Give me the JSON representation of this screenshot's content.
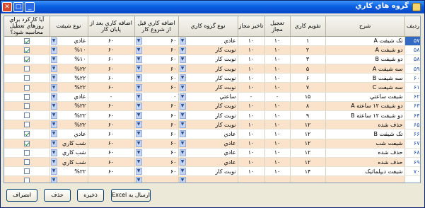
{
  "window": {
    "title": "گروه هاي كاري"
  },
  "titlebar": {
    "minimize": "_",
    "maximize": "□",
    "close": "✕"
  },
  "grid": {
    "headers": {
      "cb": "آيا كاركرد براي روزهاي تعطيل محاسبه شود؟",
      "shift_type": "نوع شيفت",
      "extra_after": "اضافه كاري بعد از پايان كار",
      "extra_before": "اضافه كاري قبل از شروع كار",
      "group_type": "نوع گروه كاري",
      "delay": "تاخير مجاز",
      "early": "تعجيل مجاز",
      "calendar": "تقويم كاري",
      "desc": "شرح",
      "id": "رديف"
    },
    "rows": [
      {
        "id": "۵۷",
        "desc": "تک شيفت A",
        "calendar": "۱",
        "early": "۱۰",
        "delay": "۱۰",
        "group_type": "عادي",
        "extra_before": "۶۰",
        "extra_after": "۶۰",
        "shift_type": "عادي",
        "checked": true
      },
      {
        "id": "۵۸",
        "desc": "دو شيفت A",
        "calendar": "۲",
        "early": "۱۰",
        "delay": "۱۰",
        "group_type": "نوبت كار",
        "extra_before": "۶۰",
        "extra_after": "۶۰",
        "shift_type": "%۱۰",
        "checked": true
      },
      {
        "id": "۵۸",
        "desc": "دو شيفت B",
        "calendar": "۳",
        "early": "۱۰",
        "delay": "۱۰",
        "group_type": "نوبت كار",
        "extra_before": "۶۰",
        "extra_after": "۶۰",
        "shift_type": "%۱۰",
        "checked": true
      },
      {
        "id": "۵۹",
        "desc": "سه شيفت A",
        "calendar": "۵",
        "early": "۱۰",
        "delay": "۱۰",
        "group_type": "نوبت كار",
        "extra_before": "۶۰",
        "extra_after": "۶۰",
        "shift_type": "%۲۲",
        "checked": false
      },
      {
        "id": "۶۰",
        "desc": "سه شيفت B",
        "calendar": "۶",
        "early": "۱۰",
        "delay": "۱۰",
        "group_type": "نوبت كار",
        "extra_before": "۶۰",
        "extra_after": "۶۰",
        "shift_type": "%۲۲",
        "checked": false
      },
      {
        "id": "۶۱",
        "desc": "سه شيفت C",
        "calendar": "۷",
        "early": "۱۰",
        "delay": "۱۰",
        "group_type": "نوبت كار",
        "extra_before": "۶۰",
        "extra_after": "۶۰",
        "shift_type": "%۲۲",
        "checked": false
      },
      {
        "id": "۶۲",
        "desc": "شيفت ساعتي",
        "calendar": "۱۵",
        "early": "۰",
        "delay": "۰",
        "group_type": "ساعتي",
        "extra_before": "۰",
        "extra_after": "۰",
        "shift_type": "عادي",
        "checked": false
      },
      {
        "id": "۶۳",
        "desc": "دو شيفت ۱۲ ساعته A",
        "calendar": "۸",
        "early": "۱۰",
        "delay": "۱۰",
        "group_type": "نوبت كار",
        "extra_before": "۶۰",
        "extra_after": "۶۰",
        "shift_type": "%۲۲",
        "checked": false
      },
      {
        "id": "۶۴",
        "desc": "دو شيفت ۱۲ ساعته B",
        "calendar": "۹",
        "early": "۱۰",
        "delay": "۱۰",
        "group_type": "نوبت كار",
        "extra_before": "۶۰",
        "extra_after": "۶۰",
        "shift_type": "%۲۲",
        "checked": false
      },
      {
        "id": "۶۵",
        "desc": "حذف شده",
        "calendar": "۱۲",
        "early": "۱۰",
        "delay": "۱۰",
        "group_type": "نوبت كار",
        "extra_before": "۶۰",
        "extra_after": "۶۰",
        "shift_type": "%۲۲",
        "checked": false
      },
      {
        "id": "۶۶",
        "desc": "تک شيفت B",
        "calendar": "۱۲",
        "early": "۱۰",
        "delay": "۱۰",
        "group_type": "عادي",
        "extra_before": "۶۰",
        "extra_after": "۶۰",
        "shift_type": "عادي",
        "checked": true
      },
      {
        "id": "۶۷",
        "desc": "شيفت شب",
        "calendar": "۱۲",
        "early": "۱۰",
        "delay": "۱۰",
        "group_type": "عادي",
        "extra_before": "۶۰",
        "extra_after": "۶۰",
        "shift_type": "شب كاري",
        "checked": true
      },
      {
        "id": "۶۸",
        "desc": "حذف شده",
        "calendar": "۱۲",
        "early": "۱۰",
        "delay": "۱۰",
        "group_type": "عادي",
        "extra_before": "۶۰",
        "extra_after": "۶۰",
        "shift_type": "شب كاري",
        "checked": false
      },
      {
        "id": "۶۹",
        "desc": "حذف شده",
        "calendar": "۱۲",
        "early": "۱۰",
        "delay": "۱۰",
        "group_type": "عادي",
        "extra_before": "۶۰",
        "extra_after": "۶۰",
        "shift_type": "شب كاري",
        "checked": false
      },
      {
        "id": "۷۰",
        "desc": "شيفت ديپلماتيک",
        "calendar": "۱۴",
        "early": "۱۰",
        "delay": "۱۰",
        "group_type": "نوبت كار",
        "extra_before": "۶۰",
        "extra_after": "۶۰",
        "shift_type": "%۲۲",
        "checked": false
      },
      {
        "id": "",
        "desc": "",
        "calendar": "",
        "early": "",
        "delay": "",
        "group_type": "",
        "extra_before": "",
        "extra_after": "",
        "shift_type": "",
        "checked": false
      }
    ]
  },
  "buttons": {
    "excel": "ارسال به Excel",
    "save": "ذخيره",
    "delete": "حذف",
    "cancel": "انصراف"
  }
}
